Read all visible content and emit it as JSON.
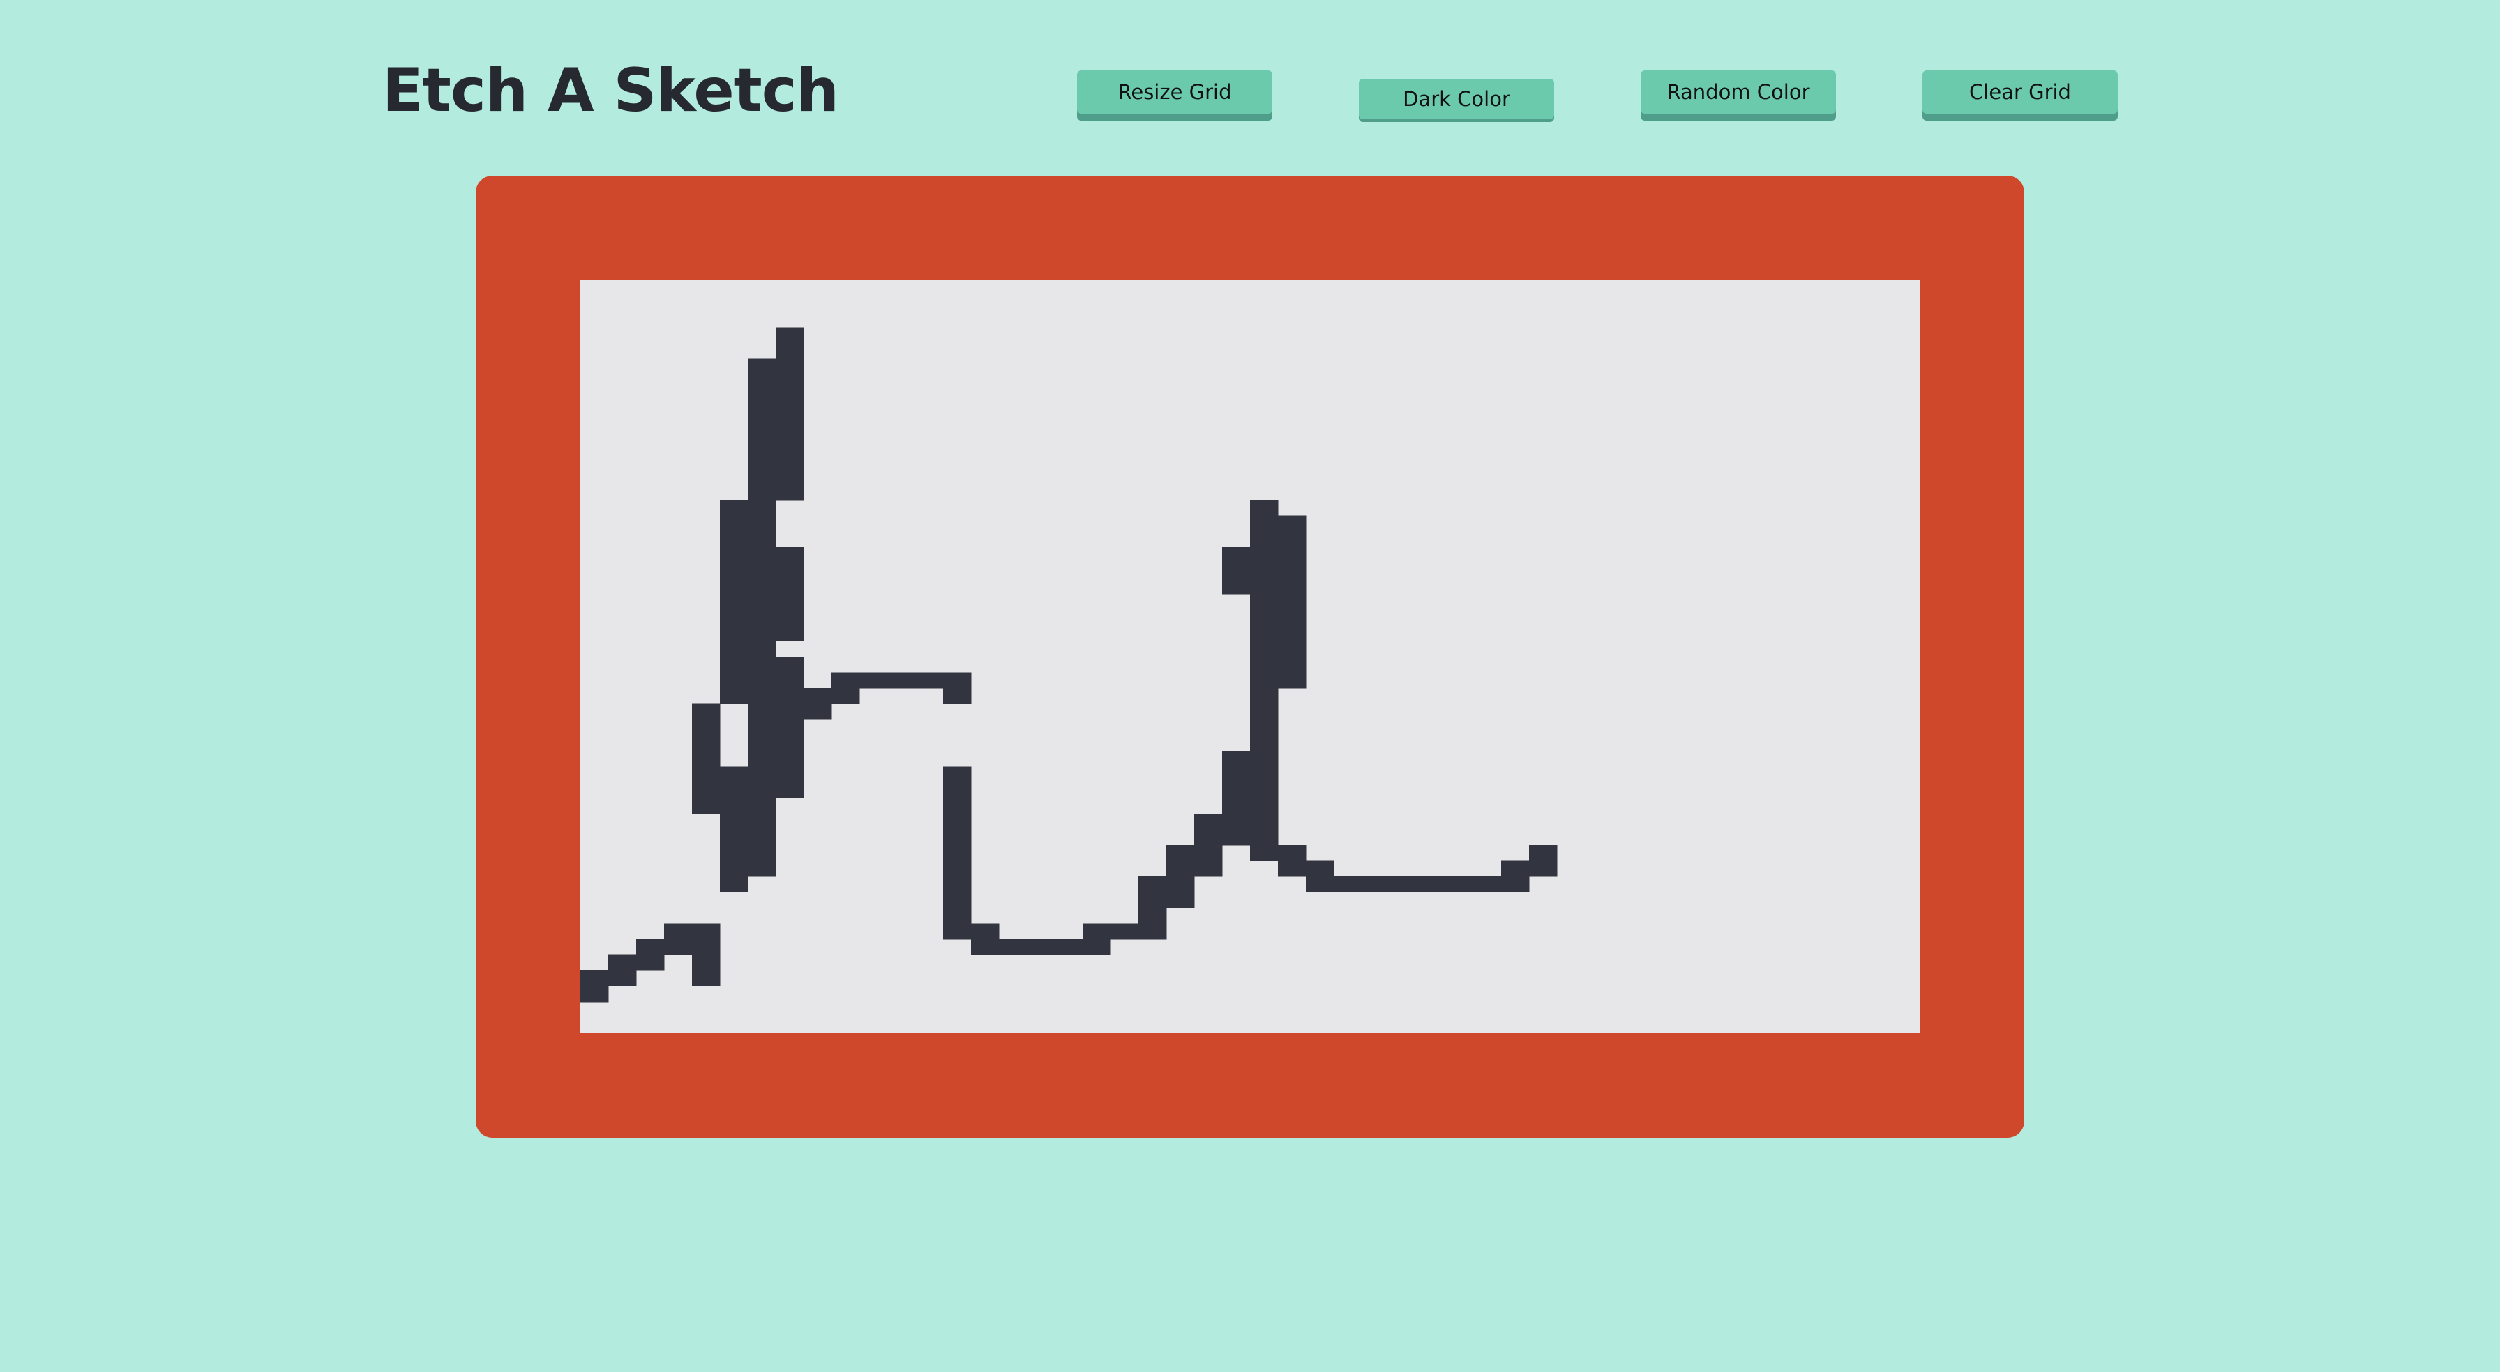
{
  "app": {
    "title": "Etch A Sketch"
  },
  "toolbar": {
    "resize_label": "Resize Grid",
    "dark_label": "Dark Color",
    "random_label": "Random Color",
    "clear_label": "Clear Grid"
  },
  "colors": {
    "background": "#b3ebdf",
    "button": "#6ccaac",
    "frame": "#d0482b",
    "screen": "#e7e7ea",
    "pen": "#32353f"
  },
  "sketch": {
    "grid_columns": 48,
    "grid_rows": 48,
    "filled_cells": [
      [
        0,
        44
      ],
      [
        0,
        45
      ],
      [
        1,
        43
      ],
      [
        1,
        44
      ],
      [
        2,
        42
      ],
      [
        2,
        43
      ],
      [
        3,
        41
      ],
      [
        3,
        42
      ],
      [
        4,
        41
      ],
      [
        4,
        42
      ],
      [
        4,
        43
      ],
      [
        4,
        44
      ],
      [
        4,
        27
      ],
      [
        4,
        28
      ],
      [
        4,
        29
      ],
      [
        4,
        30
      ],
      [
        4,
        31
      ],
      [
        4,
        32
      ],
      [
        4,
        33
      ],
      [
        5,
        14
      ],
      [
        5,
        15
      ],
      [
        5,
        16
      ],
      [
        5,
        17
      ],
      [
        5,
        18
      ],
      [
        5,
        19
      ],
      [
        5,
        20
      ],
      [
        5,
        21
      ],
      [
        5,
        22
      ],
      [
        5,
        23
      ],
      [
        5,
        24
      ],
      [
        5,
        25
      ],
      [
        5,
        26
      ],
      [
        5,
        31
      ],
      [
        5,
        32
      ],
      [
        5,
        33
      ],
      [
        5,
        34
      ],
      [
        5,
        35
      ],
      [
        5,
        36
      ],
      [
        5,
        37
      ],
      [
        5,
        38
      ],
      [
        6,
        5
      ],
      [
        6,
        6
      ],
      [
        6,
        7
      ],
      [
        6,
        8
      ],
      [
        6,
        9
      ],
      [
        6,
        10
      ],
      [
        6,
        11
      ],
      [
        6,
        12
      ],
      [
        6,
        13
      ],
      [
        6,
        14
      ],
      [
        6,
        15
      ],
      [
        6,
        16
      ],
      [
        6,
        17
      ],
      [
        6,
        18
      ],
      [
        6,
        19
      ],
      [
        6,
        20
      ],
      [
        6,
        21
      ],
      [
        6,
        22
      ],
      [
        6,
        23
      ],
      [
        6,
        24
      ],
      [
        6,
        25
      ],
      [
        6,
        26
      ],
      [
        6,
        27
      ],
      [
        6,
        28
      ],
      [
        6,
        29
      ],
      [
        6,
        30
      ],
      [
        6,
        31
      ],
      [
        6,
        32
      ],
      [
        6,
        33
      ],
      [
        6,
        34
      ],
      [
        6,
        35
      ],
      [
        6,
        36
      ],
      [
        6,
        37
      ],
      [
        7,
        3
      ],
      [
        7,
        4
      ],
      [
        7,
        5
      ],
      [
        7,
        6
      ],
      [
        7,
        7
      ],
      [
        7,
        8
      ],
      [
        7,
        9
      ],
      [
        7,
        10
      ],
      [
        7,
        11
      ],
      [
        7,
        12
      ],
      [
        7,
        13
      ],
      [
        7,
        17
      ],
      [
        7,
        18
      ],
      [
        7,
        19
      ],
      [
        7,
        20
      ],
      [
        7,
        21
      ],
      [
        7,
        22
      ],
      [
        7,
        24
      ],
      [
        7,
        25
      ],
      [
        7,
        26
      ],
      [
        7,
        27
      ],
      [
        7,
        28
      ],
      [
        7,
        29
      ],
      [
        7,
        30
      ],
      [
        7,
        31
      ],
      [
        7,
        32
      ],
      [
        8,
        26
      ],
      [
        8,
        27
      ],
      [
        9,
        25
      ],
      [
        9,
        26
      ],
      [
        10,
        25
      ],
      [
        11,
        25
      ],
      [
        12,
        25
      ],
      [
        13,
        25
      ],
      [
        13,
        26
      ],
      [
        13,
        31
      ],
      [
        13,
        32
      ],
      [
        13,
        33
      ],
      [
        13,
        34
      ],
      [
        13,
        35
      ],
      [
        13,
        36
      ],
      [
        13,
        37
      ],
      [
        13,
        38
      ],
      [
        13,
        39
      ],
      [
        13,
        40
      ],
      [
        13,
        41
      ],
      [
        14,
        41
      ],
      [
        14,
        42
      ],
      [
        15,
        42
      ],
      [
        16,
        42
      ],
      [
        17,
        42
      ],
      [
        18,
        41
      ],
      [
        18,
        42
      ],
      [
        19,
        41
      ],
      [
        20,
        38
      ],
      [
        20,
        39
      ],
      [
        20,
        40
      ],
      [
        20,
        41
      ],
      [
        21,
        36
      ],
      [
        21,
        37
      ],
      [
        21,
        38
      ],
      [
        21,
        39
      ],
      [
        22,
        34
      ],
      [
        22,
        35
      ],
      [
        22,
        36
      ],
      [
        22,
        37
      ],
      [
        23,
        17
      ],
      [
        23,
        18
      ],
      [
        23,
        19
      ],
      [
        23,
        30
      ],
      [
        23,
        31
      ],
      [
        23,
        32
      ],
      [
        23,
        33
      ],
      [
        23,
        34
      ],
      [
        23,
        35
      ],
      [
        24,
        14
      ],
      [
        24,
        15
      ],
      [
        24,
        16
      ],
      [
        24,
        17
      ],
      [
        24,
        18
      ],
      [
        24,
        19
      ],
      [
        24,
        20
      ],
      [
        24,
        21
      ],
      [
        24,
        22
      ],
      [
        24,
        23
      ],
      [
        24,
        24
      ],
      [
        24,
        25
      ],
      [
        24,
        26
      ],
      [
        24,
        27
      ],
      [
        24,
        28
      ],
      [
        24,
        29
      ],
      [
        24,
        30
      ],
      [
        24,
        31
      ],
      [
        24,
        32
      ],
      [
        24,
        33
      ],
      [
        24,
        34
      ],
      [
        24,
        35
      ],
      [
        24,
        36
      ],
      [
        25,
        15
      ],
      [
        25,
        16
      ],
      [
        25,
        17
      ],
      [
        25,
        18
      ],
      [
        25,
        19
      ],
      [
        25,
        20
      ],
      [
        25,
        21
      ],
      [
        25,
        22
      ],
      [
        25,
        23
      ],
      [
        25,
        24
      ],
      [
        25,
        25
      ],
      [
        25,
        36
      ],
      [
        25,
        37
      ],
      [
        26,
        37
      ],
      [
        26,
        38
      ],
      [
        27,
        38
      ],
      [
        28,
        38
      ],
      [
        29,
        38
      ],
      [
        30,
        38
      ],
      [
        31,
        38
      ],
      [
        32,
        38
      ],
      [
        33,
        37
      ],
      [
        33,
        38
      ],
      [
        34,
        36
      ],
      [
        34,
        37
      ]
    ]
  }
}
